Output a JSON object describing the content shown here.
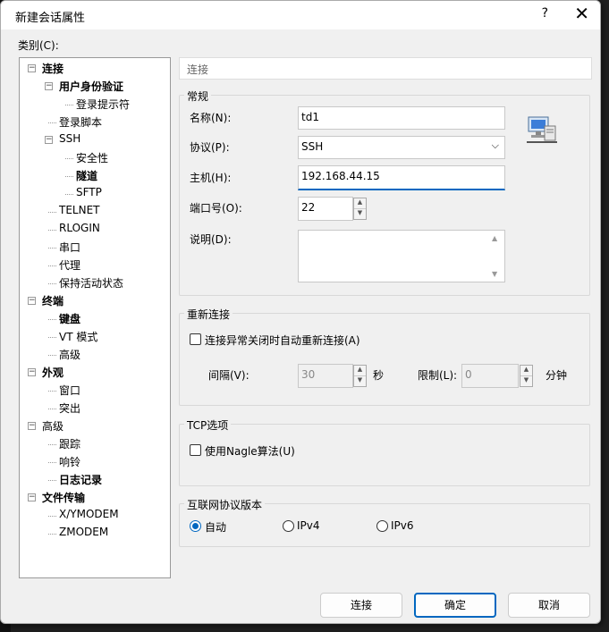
{
  "window": {
    "title": "新建会话属性",
    "help": "?",
    "close": "✕"
  },
  "category_label": "类别(C):",
  "tree": [
    {
      "label": "连接",
      "bold": true
    },
    {
      "label": "用户身份验证",
      "bold": true
    },
    {
      "label": "登录提示符",
      "bold": false
    },
    {
      "label": "登录脚本",
      "bold": false
    },
    {
      "label": "SSH",
      "bold": false
    },
    {
      "label": "安全性",
      "bold": false
    },
    {
      "label": "隧道",
      "bold": true
    },
    {
      "label": "SFTP",
      "bold": false
    },
    {
      "label": "TELNET",
      "bold": false
    },
    {
      "label": "RLOGIN",
      "bold": false
    },
    {
      "label": "串口",
      "bold": false
    },
    {
      "label": "代理",
      "bold": false
    },
    {
      "label": "保持活动状态",
      "bold": false
    },
    {
      "label": "终端",
      "bold": true
    },
    {
      "label": "键盘",
      "bold": true
    },
    {
      "label": "VT 模式",
      "bold": false
    },
    {
      "label": "高级",
      "bold": false
    },
    {
      "label": "外观",
      "bold": true
    },
    {
      "label": "窗口",
      "bold": false
    },
    {
      "label": "突出",
      "bold": false
    },
    {
      "label": "高级",
      "bold": false
    },
    {
      "label": "跟踪",
      "bold": false
    },
    {
      "label": "响铃",
      "bold": false
    },
    {
      "label": "日志记录",
      "bold": true
    },
    {
      "label": "文件传输",
      "bold": true
    },
    {
      "label": "X/YMODEM",
      "bold": false
    },
    {
      "label": "ZMODEM",
      "bold": false
    }
  ],
  "header": "连接",
  "general": {
    "title": "常规",
    "name_label": "名称(N):",
    "name_value": "td1",
    "protocol_label": "协议(P):",
    "protocol_value": "SSH",
    "host_label": "主机(H):",
    "host_value": "192.168.44.15",
    "port_label": "端口号(O):",
    "port_value": "22",
    "desc_label": "说明(D):",
    "desc_value": ""
  },
  "reconnect": {
    "title": "重新连接",
    "auto_label": "连接异常关闭时自动重新连接(A)",
    "interval_label": "间隔(V):",
    "interval_value": "30",
    "interval_unit": "秒",
    "limit_label": "限制(L):",
    "limit_value": "0",
    "limit_unit": "分钟"
  },
  "tcp": {
    "title": "TCP选项",
    "nagle_label": "使用Nagle算法(U)"
  },
  "ipver": {
    "title": "互联网协议版本",
    "auto": "自动",
    "ipv4": "IPv4",
    "ipv6": "IPv6"
  },
  "buttons": {
    "connect": "连接",
    "ok": "确定",
    "cancel": "取消"
  },
  "colors": {
    "accent": "#0067c0"
  }
}
